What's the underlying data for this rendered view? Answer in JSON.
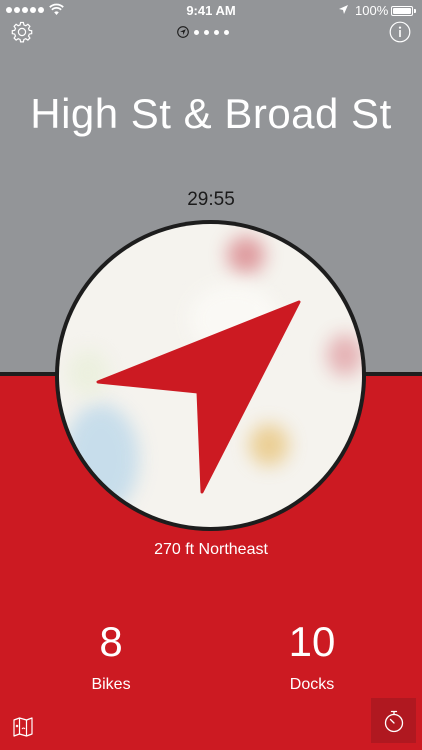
{
  "status_bar": {
    "time": "9:41 AM",
    "battery": "100%"
  },
  "station": {
    "name": "High St & Broad St",
    "countdown": "29:55",
    "distance": "270 ft Northeast"
  },
  "stats": {
    "bikes_count": "8",
    "bikes_label": "Bikes",
    "docks_count": "10",
    "docks_label": "Docks"
  },
  "pages": {
    "count": 5,
    "current": 1
  },
  "colors": {
    "header_gray": "#939598",
    "accent_red": "#cc1a22",
    "arrow_red": "#cc1a22"
  },
  "icons": {
    "settings": "gear-icon",
    "info": "info-icon",
    "map": "map-icon",
    "timer": "stopwatch-icon",
    "compass": "navigation-arrow-icon"
  }
}
